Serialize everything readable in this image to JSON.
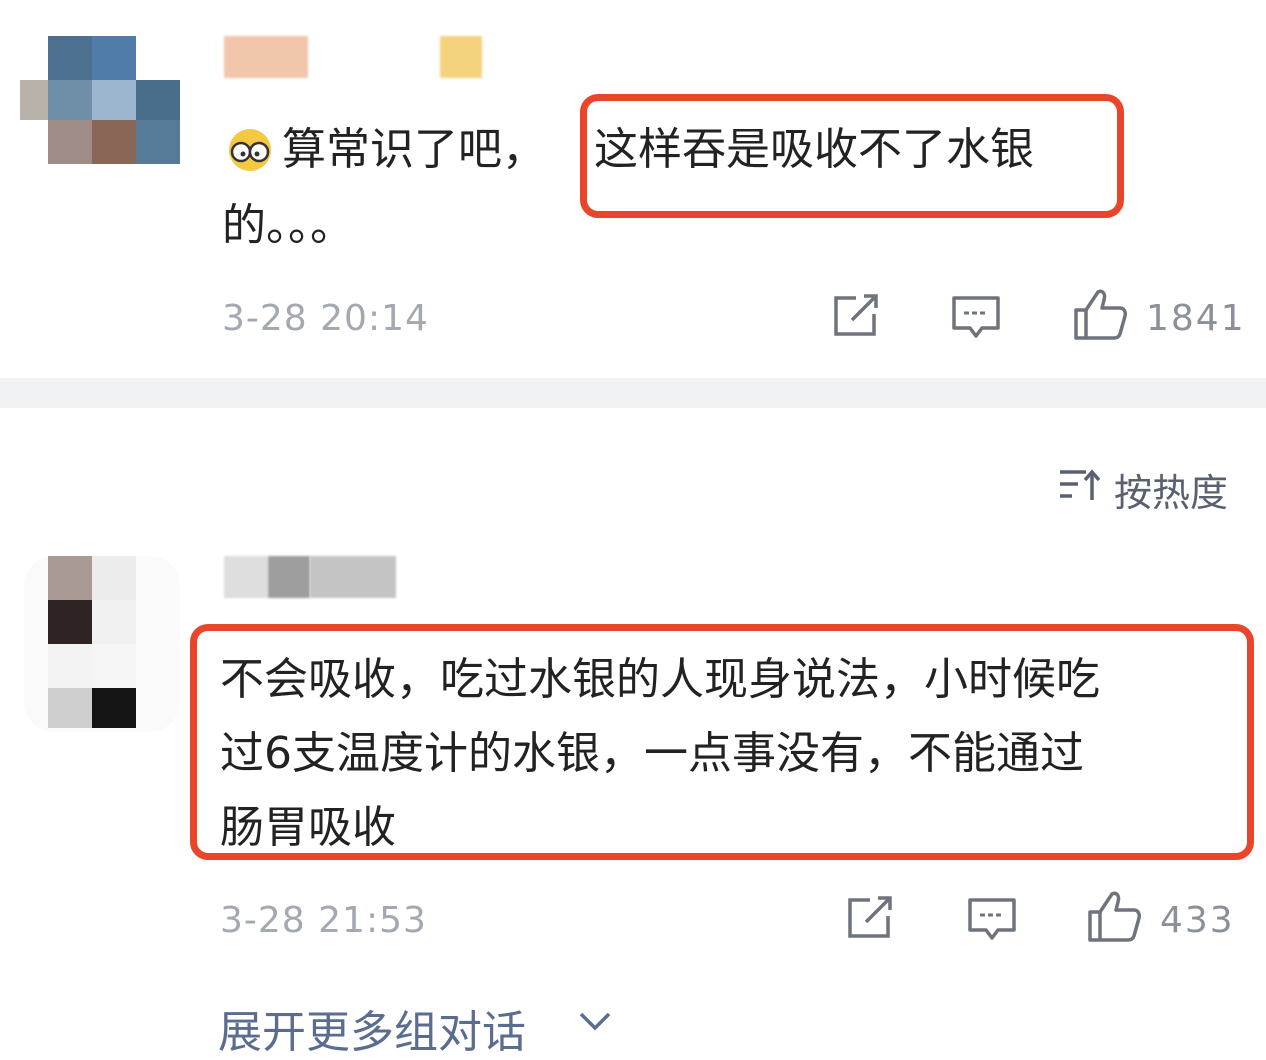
{
  "comments": [
    {
      "text_line1_pre": "算常识了吧，",
      "text_line1_hl": "这样吞是吸收不了水银",
      "text_line2": "的。。。",
      "emoji": "emoji-glasses",
      "time": "3-28 20:14",
      "likes": "1841"
    },
    {
      "line1": "不会吸收，吃过水银的人现身说法，小时候吃",
      "line2": "过6支温度计的水银，一点事没有，不能通过",
      "line3": "肠胃吸收",
      "time": "3-28 21:53",
      "likes": "433"
    }
  ],
  "sort": {
    "label": "按热度",
    "icon": "sort-up-icon"
  },
  "expand": {
    "label": "展开更多组对话",
    "icon": "chevron-down-icon"
  },
  "colors": {
    "highlight": "#e8452b",
    "meta": "#a4a8b0",
    "link": "#5b6d8e",
    "divider": "#f1f2f4"
  }
}
